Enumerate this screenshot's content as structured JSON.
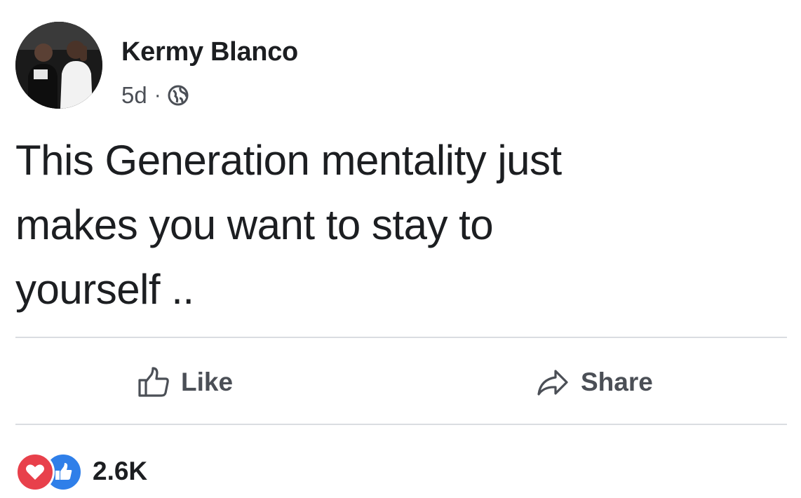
{
  "post": {
    "author": "Kermy Blanco",
    "time": "5d",
    "separator": "·",
    "privacy_icon": "globe-icon",
    "text": "This Generation mentality just\nmakes you want to stay to\nyourself .."
  },
  "actions": {
    "like": {
      "label": "Like",
      "icon": "thumbs-up-icon"
    },
    "share": {
      "label": "Share",
      "icon": "share-arrow-icon"
    }
  },
  "reactions": {
    "icons": [
      "heart-reaction-icon",
      "like-reaction-icon"
    ],
    "count": "2.6K"
  },
  "colors": {
    "text": "#1c1e21",
    "muted": "#4b4f56",
    "divider": "#dadde1",
    "heart": "#e8404b",
    "like": "#2f7fe9"
  }
}
